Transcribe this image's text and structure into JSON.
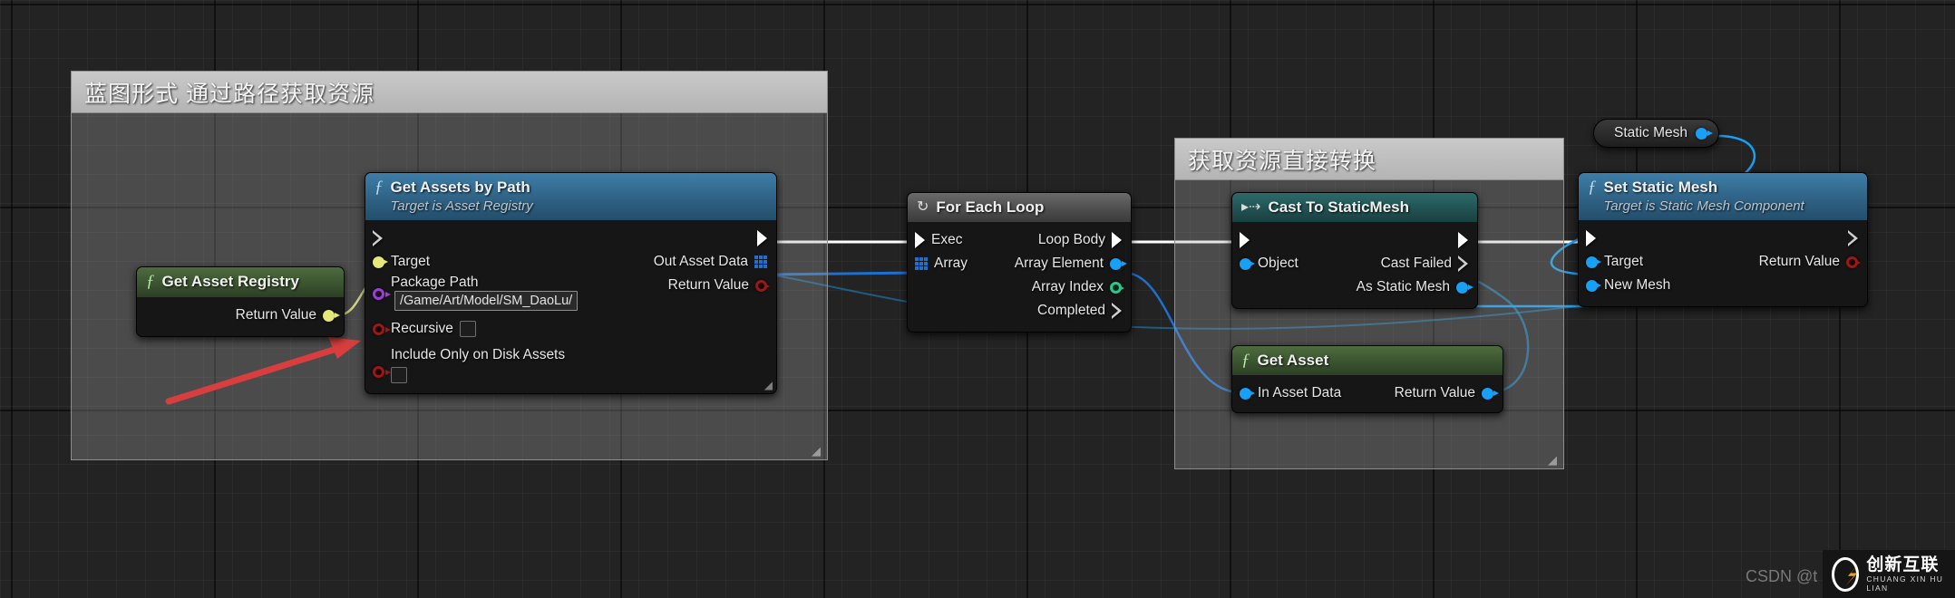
{
  "comments": [
    {
      "id": "c1",
      "title": "蓝图形式 通过路径获取资源"
    },
    {
      "id": "c2",
      "title": "获取资源直接转换"
    }
  ],
  "nodes": {
    "get_asset_registry": {
      "title": "Get Asset Registry",
      "icon": "function-f-icon",
      "outputs": [
        {
          "label": "Return Value",
          "pin": "object-pin"
        }
      ]
    },
    "get_assets_by_path": {
      "title": "Get Assets by Path",
      "subtitle": "Target is Asset Registry",
      "icon": "function-f-icon",
      "inputs": [
        {
          "label": "Target",
          "pin": "object-pin"
        },
        {
          "label": "Package Path",
          "pin": "name-pin",
          "value": "/Game/Art/Model/SM_DaoLu/"
        },
        {
          "label": "Recursive",
          "pin": "bool-pin",
          "checked": false
        },
        {
          "label": "Include Only on Disk Assets",
          "pin": "bool-pin",
          "checked": false
        }
      ],
      "outputs": [
        {
          "label": "Out Asset Data",
          "pin": "struct-array-pin"
        },
        {
          "label": "Return Value",
          "pin": "bool-pin"
        }
      ]
    },
    "for_each_loop": {
      "title": "For Each Loop",
      "icon": "loop-icon",
      "inputs": [
        {
          "label": "Exec",
          "pin": "exec-pin"
        },
        {
          "label": "Array",
          "pin": "struct-array-pin"
        }
      ],
      "outputs": [
        {
          "label": "Loop Body",
          "pin": "exec-pin"
        },
        {
          "label": "Array Element",
          "pin": "object-blue-pin"
        },
        {
          "label": "Array Index",
          "pin": "int-pin"
        },
        {
          "label": "Completed",
          "pin": "exec-pin"
        }
      ]
    },
    "cast_to_staticmesh": {
      "title": "Cast To StaticMesh",
      "icon": "cast-arrow-icon",
      "inputs": [
        {
          "label": "Object",
          "pin": "object-blue-pin"
        }
      ],
      "outputs": [
        {
          "label": "Cast Failed",
          "pin": "exec-pin"
        },
        {
          "label": "As Static Mesh",
          "pin": "object-blue-pin"
        }
      ]
    },
    "get_asset": {
      "title": "Get Asset",
      "icon": "function-f-icon",
      "inputs": [
        {
          "label": "In Asset Data",
          "pin": "object-blue-pin"
        }
      ],
      "outputs": [
        {
          "label": "Return Value",
          "pin": "object-blue-pin"
        }
      ]
    },
    "set_static_mesh": {
      "title": "Set Static Mesh",
      "subtitle": "Target is Static Mesh Component",
      "icon": "function-f-icon",
      "inputs": [
        {
          "label": "Target",
          "pin": "object-blue-pin"
        },
        {
          "label": "New Mesh",
          "pin": "object-blue-pin"
        }
      ],
      "outputs": [
        {
          "label": "Return Value",
          "pin": "bool-pin"
        }
      ]
    },
    "static_mesh_var": {
      "title": "Static Mesh",
      "pin": "object-blue-pin"
    }
  },
  "annotation": {
    "type": "red-arrow",
    "color": "#ee1111"
  },
  "watermark": {
    "csdn": "CSDN @t",
    "brand_cn": "创新互联",
    "brand_en": "CHUANG XIN HU LIAN"
  },
  "colors": {
    "exec_white": "#ffffff",
    "object_yellow": "#e3e879",
    "name_purple": "#9b3fd4",
    "bool_red": "#9e1717",
    "struct_blue": "#1e6fd0",
    "object_blue": "#17a0f5",
    "int_green": "#28c98c",
    "annotation_red": "#ee1111"
  }
}
